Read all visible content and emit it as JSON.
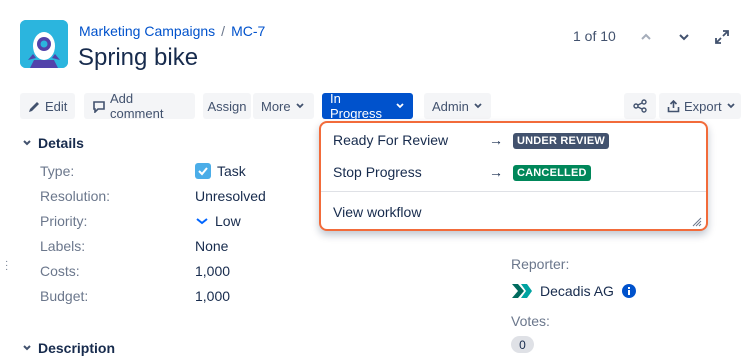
{
  "breadcrumb": {
    "project": "Marketing Campaigns",
    "separator": "/",
    "issue_key": "MC-7"
  },
  "issue": {
    "title": "Spring bike"
  },
  "pager": {
    "text": "1 of 10"
  },
  "toolbar": {
    "edit": "Edit",
    "add_comment": "Add comment",
    "assign": "Assign",
    "more": "More",
    "status": "In Progress",
    "admin": "Admin",
    "export": "Export"
  },
  "details": {
    "heading": "Details",
    "fields": [
      {
        "label": "Type:",
        "value": "Task"
      },
      {
        "label": "Resolution:",
        "value": "Unresolved"
      },
      {
        "label": "Priority:",
        "value": "Low"
      },
      {
        "label": "Labels:",
        "value": "None"
      },
      {
        "label": "Costs:",
        "value": "1,000"
      },
      {
        "label": "Budget:",
        "value": "1,000"
      }
    ]
  },
  "people": {
    "reporter_label": "Reporter:",
    "reporter_name": "Decadis AG",
    "votes_label": "Votes:",
    "votes_count": "0"
  },
  "description": {
    "heading": "Description"
  },
  "transitions_menu": {
    "items": [
      {
        "label": "Ready For Review",
        "arrow": "→",
        "status": "UNDER REVIEW",
        "status_color": "#42526e"
      },
      {
        "label": "Stop Progress",
        "arrow": "→",
        "status": "CANCELLED",
        "status_color": "#00875a"
      }
    ],
    "view_workflow": "View workflow"
  },
  "colors": {
    "primary": "#0052cc",
    "highlight_border": "#f26b3a",
    "avatar_bg": "#2bb5de"
  }
}
